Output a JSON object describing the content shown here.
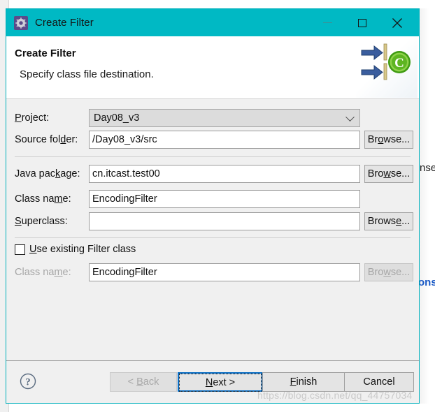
{
  "window": {
    "title": "Create Filter",
    "icon": "gear-icon",
    "accent_color": "#00b9c4",
    "controls": {
      "minimize": "minimize-icon",
      "maximize": "maximize-icon",
      "close": "close-icon"
    }
  },
  "header": {
    "title": "Create Filter",
    "description": "Specify class file destination.",
    "banner_icon": "java-class-wizard-icon"
  },
  "form": {
    "project": {
      "label": "Project:",
      "mnemonic": "P",
      "value": "Day08_v3",
      "control": "combobox",
      "chevron": "chevron-down-icon"
    },
    "source_folder": {
      "label_pre": "Source fol",
      "mnemonic": "d",
      "label_post": "er:",
      "value": "/Day08_v3/src",
      "browse_label_pre": "Br",
      "browse_mnemonic": "o",
      "browse_label_post": "wse...",
      "browse_full": "Browse..."
    },
    "java_package": {
      "label_pre": "Java pac",
      "mnemonic": "k",
      "label_post": "age:",
      "value": "cn.itcast.test00",
      "placeholder": "",
      "browse_label_pre": "Bro",
      "browse_mnemonic": "w",
      "browse_label_post": "se...",
      "browse_full": "Browse..."
    },
    "class_name": {
      "label_pre": "Class na",
      "mnemonic": "m",
      "label_post": "e:",
      "value": "EncodingFilter",
      "placeholder": ""
    },
    "superclass": {
      "label_pre": "",
      "mnemonic": "S",
      "label_post": "uperclass:",
      "value": "",
      "placeholder": "",
      "browse_label_pre": "Brows",
      "browse_mnemonic": "e",
      "browse_label_post": "...",
      "browse_full": "Browse..."
    },
    "use_existing": {
      "label_pre": "",
      "mnemonic": "U",
      "label_post": "se existing Filter class",
      "checked": false
    },
    "existing_class_name": {
      "label_pre": "Class na",
      "mnemonic": "m",
      "label_post": "e:",
      "value": "EncodingFilter",
      "disabled": true,
      "browse_label_pre": "Bro",
      "browse_mnemonic": "w",
      "browse_label_post": "se...",
      "browse_full": "Browse...",
      "browse_disabled": true
    }
  },
  "footer": {
    "help": "help-icon",
    "back": {
      "label_pre": "< ",
      "mnemonic": "B",
      "label_post": "ack",
      "full": "< Back",
      "disabled": true
    },
    "next": {
      "label_pre": "",
      "mnemonic": "N",
      "label_post": "ext >",
      "full": "Next >",
      "focused": true
    },
    "finish": {
      "label_pre": "",
      "mnemonic": "F",
      "label_post": "inish",
      "full": "Finish"
    },
    "cancel": {
      "label_pre": "",
      "mnemonic": "",
      "label_post": "Cancel",
      "full": "Cancel"
    }
  },
  "background": {
    "text_1": "nse",
    "text_2": "ons"
  },
  "watermark": "https://blog.csdn.net/qq_44757034"
}
